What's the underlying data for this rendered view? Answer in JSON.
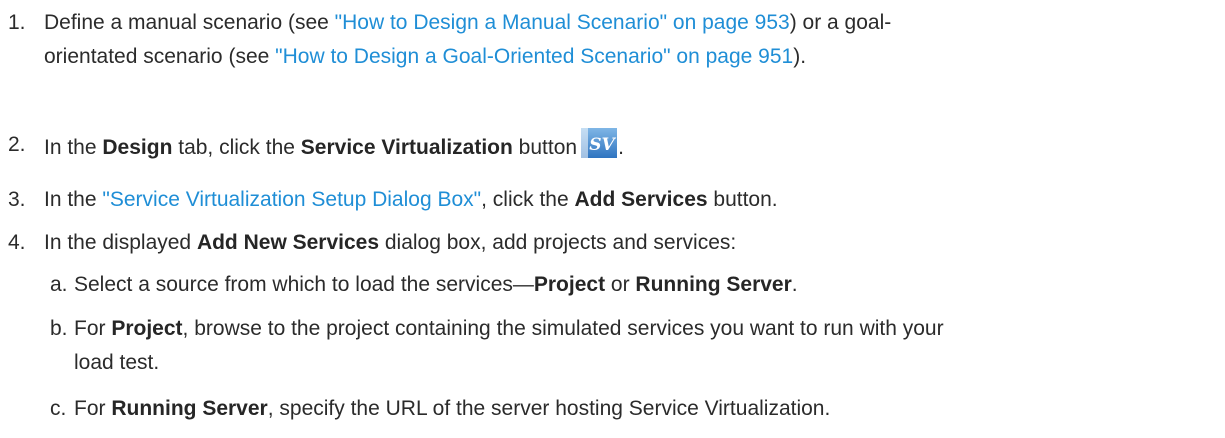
{
  "steps": [
    {
      "number": "1.",
      "line1_pre": "Define a manual scenario (see ",
      "line1_link": "\"How to Design a Manual Scenario\" on page 953",
      "line1_post": ") or a goal-",
      "line2_pre": "orientated scenario (see ",
      "line2_link": "\"How to Design a Goal-Oriented Scenario\" on page 951",
      "line2_post": ")."
    },
    {
      "number": "2.",
      "pre": "In the ",
      "bold1": "Design",
      "mid": " tab, click the ",
      "bold2": "Service Virtualization",
      "post": " button",
      "icon": "service-virtualization-icon",
      "icon_text": "SV",
      "end": "."
    },
    {
      "number": "3.",
      "pre": "In the ",
      "link": "\"Service Virtualization Setup Dialog Box\"",
      "mid": ", click the ",
      "bold": "Add Services",
      "post": " button."
    },
    {
      "number": "4.",
      "pre": "In the displayed ",
      "bold": "Add New Services",
      "post": " dialog box, add projects and services:"
    }
  ],
  "substeps": [
    {
      "letter": "a.",
      "pre": "Select a source from which to load the services—",
      "bold1": "Project",
      "mid": " or ",
      "bold2": "Running Server",
      "post": "."
    },
    {
      "letter": "b.",
      "pre": "For ",
      "bold": "Project",
      "post": ", browse to the project containing the simulated services you want to run with your",
      "line2": "load test."
    },
    {
      "letter": "c.",
      "pre": "For ",
      "bold": "Running Server",
      "post": ", specify the URL of the server hosting Service Virtualization."
    }
  ],
  "colors": {
    "link": "#1f8ed6",
    "text": "#2b2b2b"
  }
}
